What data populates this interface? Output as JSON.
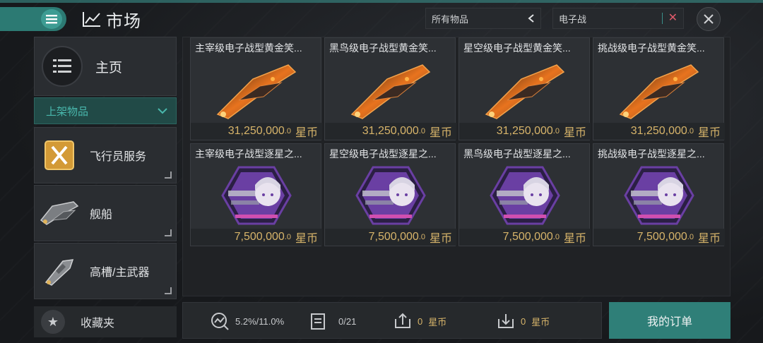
{
  "header": {
    "title": "市场",
    "filter_value": "所有物品",
    "search_value": "电子战"
  },
  "sidebar": {
    "home_label": "主页",
    "dropdown_label": "上架物品",
    "items": [
      {
        "label": "飞行员服务",
        "icon": "pilot-service-icon"
      },
      {
        "label": "舰船",
        "icon": "ship-icon"
      },
      {
        "label": "高槽/主武器",
        "icon": "high-slot-weapon-icon"
      }
    ],
    "favorites_label": "收藏夹"
  },
  "cards": [
    {
      "name": "主宰级电子战型黄金笑...",
      "price": "31,250,000",
      "price_dec": ".0",
      "currency": "星币",
      "art": "gold-skin-ship"
    },
    {
      "name": "黑鸟级电子战型黄金笑...",
      "price": "31,250,000",
      "price_dec": ".0",
      "currency": "星币",
      "art": "gold-skin-ship"
    },
    {
      "name": "星空级电子战型黄金笑...",
      "price": "31,250,000",
      "price_dec": ".0",
      "currency": "星币",
      "art": "gold-skin-ship"
    },
    {
      "name": "挑战级电子战型黄金笑...",
      "price": "31,250,000",
      "price_dec": ".0",
      "currency": "星币",
      "art": "gold-skin-ship"
    },
    {
      "name": "主宰级电子战型逐星之...",
      "price": "7,500,000",
      "price_dec": ".0",
      "currency": "星币",
      "art": "pilot-portrait-hex"
    },
    {
      "name": "星空级电子战型逐星之...",
      "price": "7,500,000",
      "price_dec": ".0",
      "currency": "星币",
      "art": "pilot-portrait-hex"
    },
    {
      "name": "黑鸟级电子战型逐星之...",
      "price": "7,500,000",
      "price_dec": ".0",
      "currency": "星币",
      "art": "pilot-portrait-hex"
    },
    {
      "name": "挑战级电子战型逐星之...",
      "price": "7,500,000",
      "price_dec": ".0",
      "currency": "星币",
      "art": "pilot-portrait-hex"
    }
  ],
  "bottom": {
    "tax_rate": "5.2%/11.0%",
    "orders_count": "0/21",
    "sell_value": "0",
    "sell_currency": "星币",
    "buy_value": "0",
    "buy_currency": "星币",
    "my_orders_label": "我的订单"
  },
  "colors": {
    "accent": "#2f7f78",
    "price_gold": "#d7b46a",
    "skin_orange": "#e8731e",
    "portrait_purple": "#6a3fa3"
  }
}
